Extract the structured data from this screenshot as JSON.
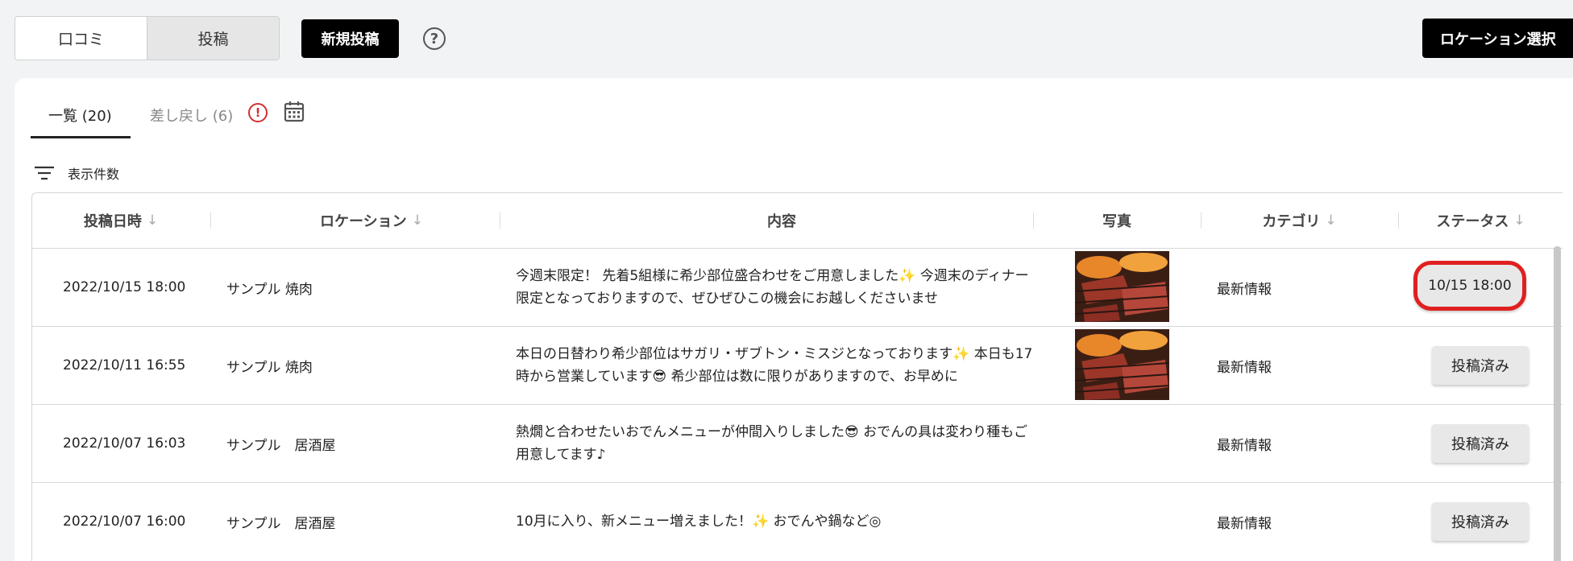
{
  "top": {
    "seg_reviews": "口コミ",
    "seg_posts": "投稿",
    "new_post": "新規投稿",
    "help": "?",
    "location_select": "ロケーション選択"
  },
  "tabs": {
    "list": "一覧 (20)",
    "returned": "差し戻し (6)",
    "alert_mark": "!"
  },
  "filter": {
    "label": "表示件数"
  },
  "columns": {
    "posted_at": "投稿日時",
    "location": "ロケーション",
    "content": "内容",
    "photo": "写真",
    "category": "カテゴリ",
    "status": "ステータス",
    "sort_icon": "↓"
  },
  "rows": [
    {
      "date": "2022/10/15 18:00",
      "location": "サンプル 焼肉",
      "content": "今週末限定！ 先着5組様に希少部位盛合わせをご用意しました✨ 今週末のディナー限定となっておりますので、ぜひぜひこの機会にお越しくださいませ",
      "has_photo": true,
      "category": "最新情報",
      "status": "10/15 18:00"
    },
    {
      "date": "2022/10/11 16:55",
      "location": "サンプル 焼肉",
      "content": "本日の日替わり希少部位はサガリ・ザブトン・ミスジとなっております✨ 本日も17時から営業しています😎 希少部位は数に限りがありますので、お早めに",
      "has_photo": true,
      "category": "最新情報",
      "status": "投稿済み"
    },
    {
      "date": "2022/10/07 16:03",
      "location": "サンプル　居酒屋",
      "content": "熱燗と合わせたいおでんメニューが仲間入りしました😎 おでんの具は変わり種もご用意してます♪",
      "has_photo": false,
      "category": "最新情報",
      "status": "投稿済み"
    },
    {
      "date": "2022/10/07 16:00",
      "location": "サンプル　居酒屋",
      "content": "10月に入り、新メニュー増えました！✨ おでんや鍋など◎",
      "has_photo": false,
      "category": "最新情報",
      "status": "投稿済み"
    }
  ],
  "colors": {
    "primary": "#000000",
    "alert": "#d32f2f",
    "highlight": "#e02020"
  }
}
